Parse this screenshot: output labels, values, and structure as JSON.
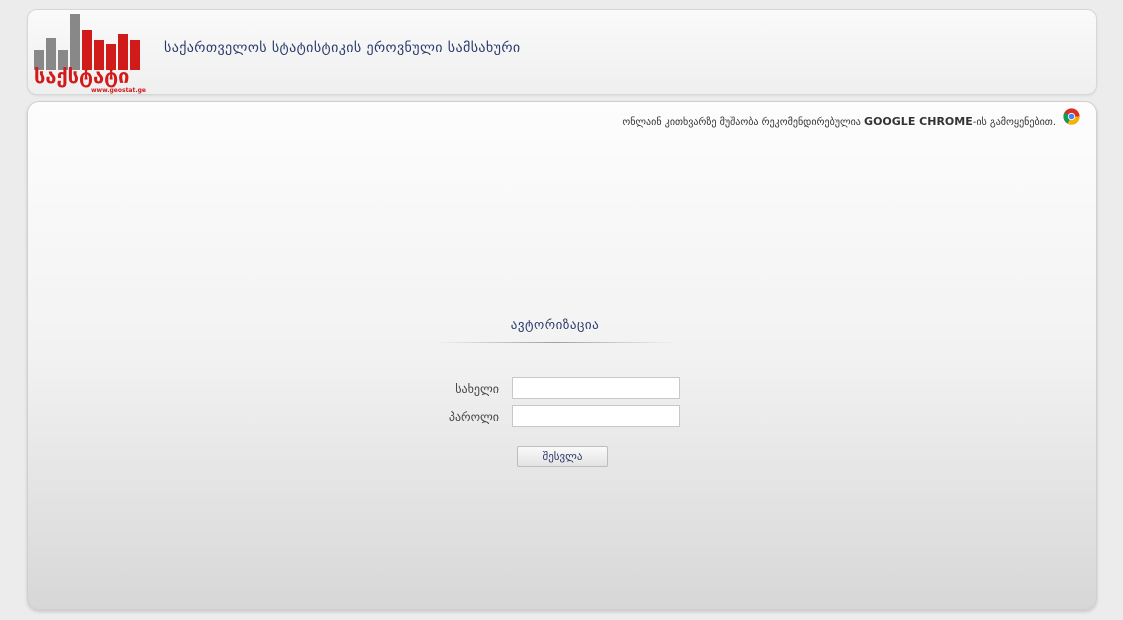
{
  "header": {
    "logo_text": "საქსტატი",
    "logo_domain": "www.geostat.ge",
    "title": "საქართველოს სტატისტიკის ეროვნული სამსახური"
  },
  "notice": {
    "text_before": "ონლაინ კითხვარზე მუშაობა რეკომენდირებულია ",
    "browser": "GOOGLE CHROME",
    "text_after": "-ის გამოყენებით.",
    "icon": "chrome-icon"
  },
  "auth": {
    "title": "ავტორიზაცია",
    "username_label": "სახელი",
    "username_value": "",
    "password_label": "პაროლი",
    "password_value": "",
    "submit_label": "შესვლა"
  },
  "colors": {
    "brand_red": "#d11a1a",
    "title_blue": "#2a3b6a",
    "bar_gray": "#888888"
  }
}
